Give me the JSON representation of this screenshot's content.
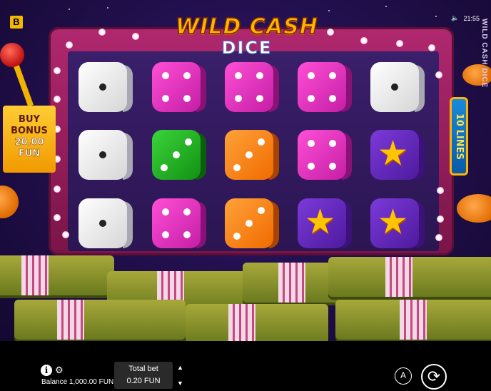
{
  "brand_badge": "B",
  "status": {
    "time": "21:55",
    "sound_icon": "speaker-icon"
  },
  "game_title_vertical": "WILD CASH DICE",
  "logo": {
    "top": "WILD CASH",
    "bottom": "DICE"
  },
  "buy_bonus": {
    "line1": "BUY",
    "line2": "BONUS",
    "amount": "20.00",
    "currency": "FUN"
  },
  "lines_label": "10 LINES",
  "reels": [
    [
      "white-1",
      "white-1",
      "white-1"
    ],
    [
      "pink-4",
      "green-3",
      "pink-4"
    ],
    [
      "pink-4",
      "orange-3",
      "orange-3"
    ],
    [
      "pink-4",
      "pink-4",
      "star"
    ],
    [
      "white-1",
      "star",
      "star"
    ]
  ],
  "colors": {
    "accent": "#ffb400",
    "frame": "#b0286f",
    "reel_bg": "#2b1552"
  },
  "bottom_bar": {
    "info_icon": "info-icon",
    "settings_icon": "gear-icon",
    "balance_label": "Balance",
    "balance_value": "1,000.00 FUN",
    "total_bet_label": "Total bet",
    "total_bet_value": "0.20 FUN",
    "bet_up_icon": "triangle-up-icon",
    "bet_down_icon": "triangle-down-icon",
    "autoplay_label": "A",
    "spin_icon": "refresh-icon"
  }
}
